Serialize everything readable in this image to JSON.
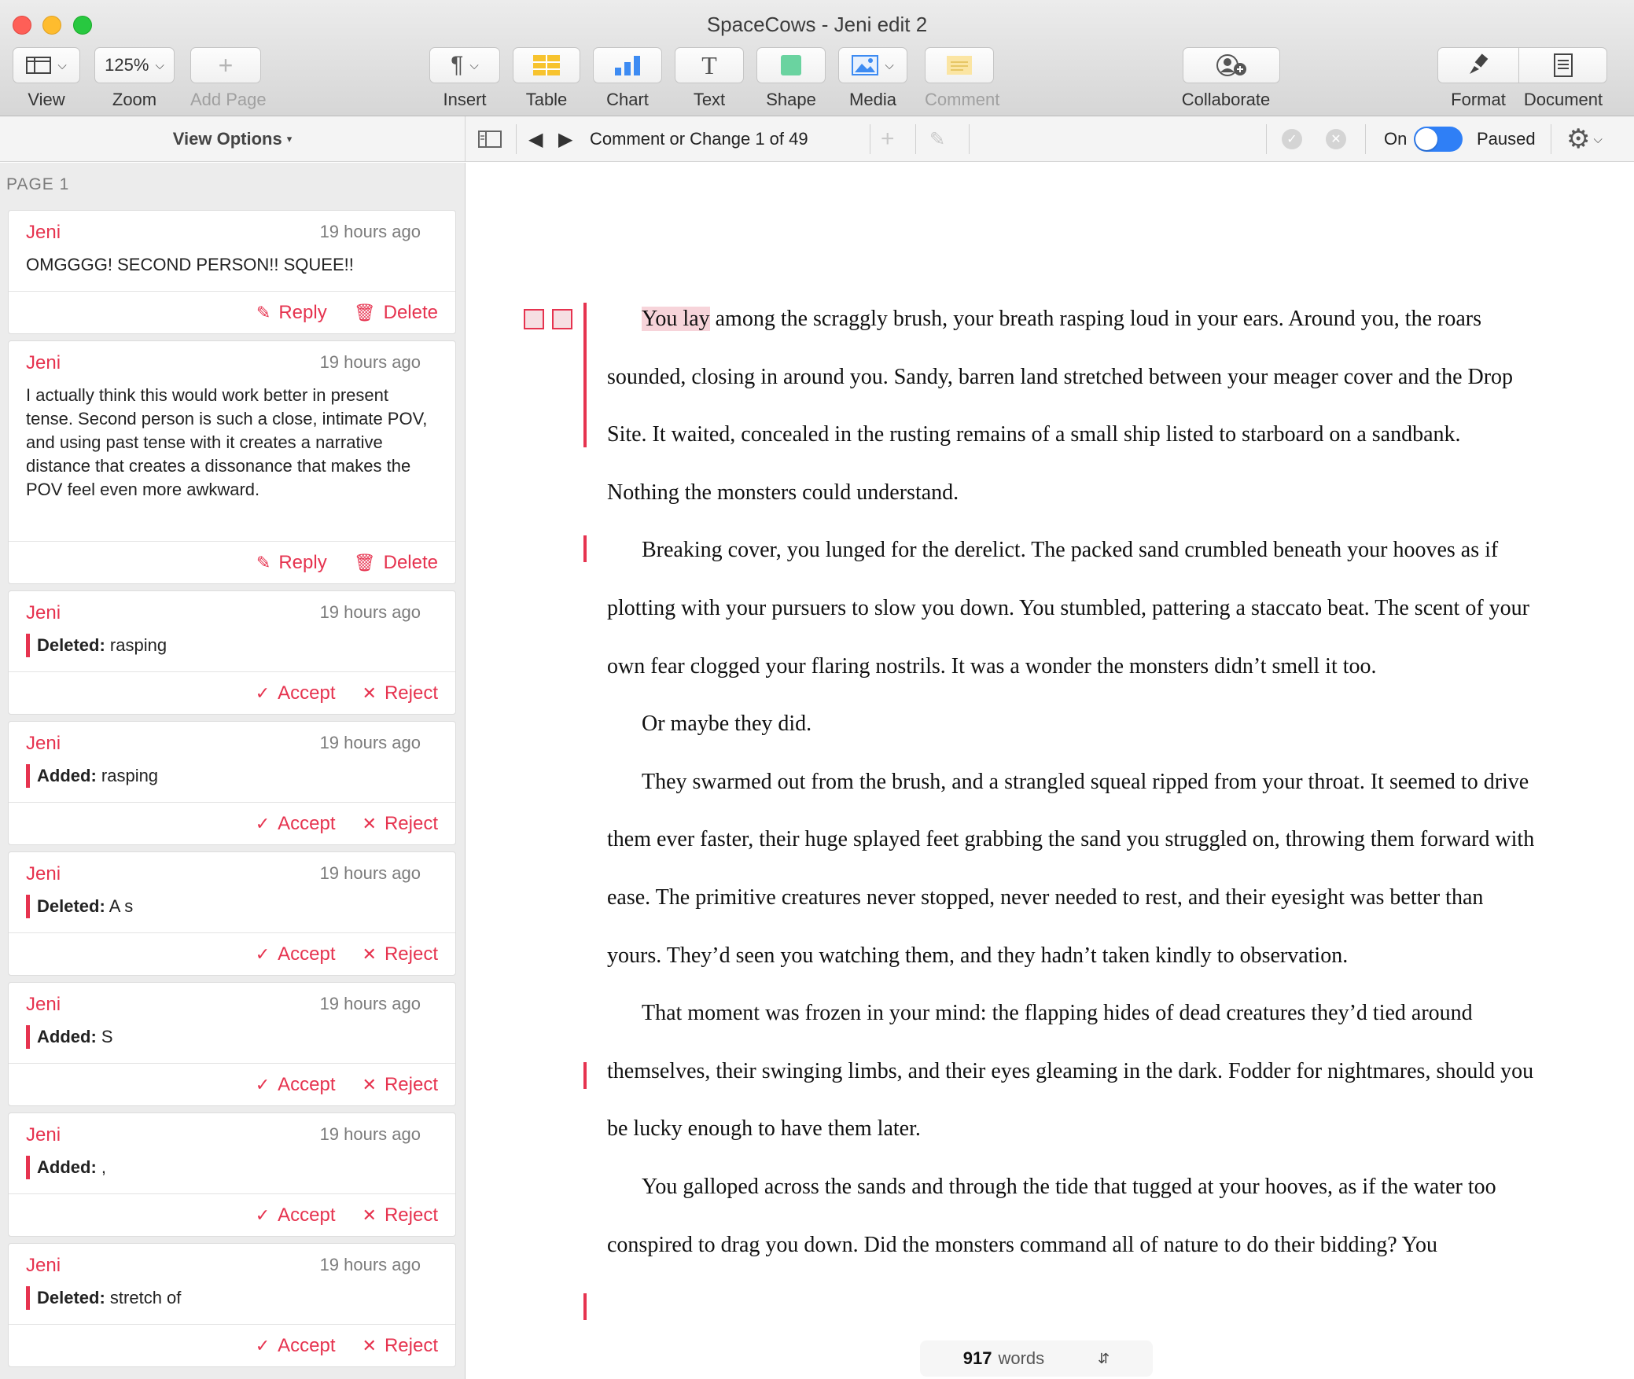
{
  "window": {
    "title": "SpaceCows - Jeni edit 2"
  },
  "toolbar": {
    "view": "View",
    "zoom_value": "125%",
    "zoom": "Zoom",
    "add_page": "Add Page",
    "insert": "Insert",
    "table": "Table",
    "chart": "Chart",
    "text": "Text",
    "shape": "Shape",
    "media": "Media",
    "comment": "Comment",
    "collaborate": "Collaborate",
    "format": "Format",
    "document": "Document"
  },
  "subbar": {
    "view_options": "View Options",
    "nav_label": "Comment or Change 1 of 49",
    "tracking_on": "On",
    "tracking_state": "Paused"
  },
  "sidebar": {
    "page_label": "PAGE 1",
    "cards": [
      {
        "author": "Jeni",
        "time": "19 hours ago",
        "text": "OMGGGG! SECOND PERSON!! SQUEE!!",
        "reply": "Reply",
        "delete": "Delete"
      },
      {
        "author": "Jeni",
        "time": "19 hours ago",
        "text": "I actually think this would work better in present tense. Second person is such a close, intimate POV, and using past tense with it creates a narrative distance that creates a dissonance that makes the POV feel even more awkward.",
        "reply": "Reply",
        "delete": "Delete"
      },
      {
        "author": "Jeni",
        "time": "19 hours ago",
        "kind": "Deleted:",
        "value": "rasping",
        "accept": "Accept",
        "reject": "Reject"
      },
      {
        "author": "Jeni",
        "time": "19 hours ago",
        "kind": "Added:",
        "value": "rasping",
        "accept": "Accept",
        "reject": "Reject"
      },
      {
        "author": "Jeni",
        "time": "19 hours ago",
        "kind": "Deleted:",
        "value": "A s",
        "accept": "Accept",
        "reject": "Reject"
      },
      {
        "author": "Jeni",
        "time": "19 hours ago",
        "kind": "Added:",
        "value": "S",
        "accept": "Accept",
        "reject": "Reject"
      },
      {
        "author": "Jeni",
        "time": "19 hours ago",
        "kind": "Added:",
        "value": ",",
        "accept": "Accept",
        "reject": "Reject"
      },
      {
        "author": "Jeni",
        "time": "19 hours ago",
        "kind": "Deleted:",
        "value": "stretch of",
        "accept": "Accept",
        "reject": "Reject"
      }
    ]
  },
  "document": {
    "p1_highlight": "You lay",
    "p1_rest": " among the scraggly brush, your breath rasping loud in your ears. Around you, the roars sounded, closing in around you. Sandy, barren land stretched between your meager cover and the Drop Site. It waited, concealed in the rusting remains of a small ship listed to starboard on a sandbank. Nothing the monsters could understand.",
    "p2": "Breaking cover, you lunged for the derelict. The packed sand crumbled beneath your hooves as if plotting with your pursuers to slow you down. You stumbled, pattering a staccato beat. The scent of your own fear clogged your flaring nostrils. It was a wonder the monsters didn’t smell it too.",
    "p3": "Or maybe they did.",
    "p4": "They swarmed out from the brush, and a strangled squeal ripped from your throat. It seemed to drive them ever faster, their huge splayed feet grabbing the sand you struggled on, throwing them forward with ease. The primitive creatures never stopped, never needed to rest, and their eyesight was better than yours. They’d seen you watching them, and they hadn’t taken kindly to observation.",
    "p5": "That moment was frozen in your mind: the flapping hides of dead creatures they’d tied around themselves, their swinging limbs, and their eyes gleaming in the dark. Fodder for nightmares, should you be lucky enough to have them later.",
    "p6": "You galloped across the sands and through the tide that tugged at your hooves, as if the water too conspired to drag you down. Did the monsters command all of nature to do their bidding? You",
    "word_count": "917",
    "word_label": "words"
  }
}
